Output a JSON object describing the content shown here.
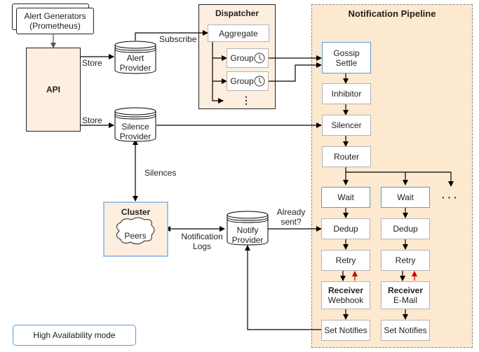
{
  "alert_generators": {
    "line1": "Alert Generators",
    "line2": "(Prometheus)"
  },
  "api": {
    "label": "API"
  },
  "arrows": {
    "store_alert": "Store",
    "store_silence": "Store",
    "subscribe": "Subscribe",
    "silences": "Silences",
    "notification_logs_line1": "Notification",
    "notification_logs_line2": "Logs",
    "already_sent_line1": "Already",
    "already_sent_line2": "sent?"
  },
  "alert_provider": {
    "line1": "Alert",
    "line2": "Provider"
  },
  "silence_provider": {
    "line1": "Silence",
    "line2": "Provider"
  },
  "notify_provider": {
    "line1": "Notify",
    "line2": "Provider"
  },
  "dispatcher": {
    "title": "Dispatcher",
    "aggregate": "Aggregate",
    "groups": [
      {
        "label": "Group",
        "icon": "clock-icon"
      },
      {
        "label": "Group",
        "icon": "clock-icon"
      }
    ],
    "more": "⋮"
  },
  "cluster": {
    "title": "Cluster",
    "peers": "Peers"
  },
  "pipeline": {
    "title": "Notification Pipeline",
    "gossip_line1": "Gossip",
    "gossip_line2": "Settle",
    "inhibitor": "Inhibitor",
    "silencer": "Silencer",
    "router": "Router",
    "more": "· · ·",
    "branches": [
      {
        "wait": "Wait",
        "dedup": "Dedup",
        "retry": "Retry",
        "receiver_title": "Receiver",
        "receiver_type": "Webhook",
        "set_notifies": "Set Notifies"
      },
      {
        "wait": "Wait",
        "dedup": "Dedup",
        "retry": "Retry",
        "receiver_title": "Receiver",
        "receiver_type": "E-Mail",
        "set_notifies": "Set Notifies"
      }
    ]
  },
  "legend": {
    "label": "High Availability mode"
  },
  "colors": {
    "fill_peach": "#fdeee0",
    "pipeline_fill": "#fde9cf",
    "blue_border": "#5b9bd5",
    "retry_arrow": "#cc0000",
    "grey_border": "#b3b3b3"
  }
}
